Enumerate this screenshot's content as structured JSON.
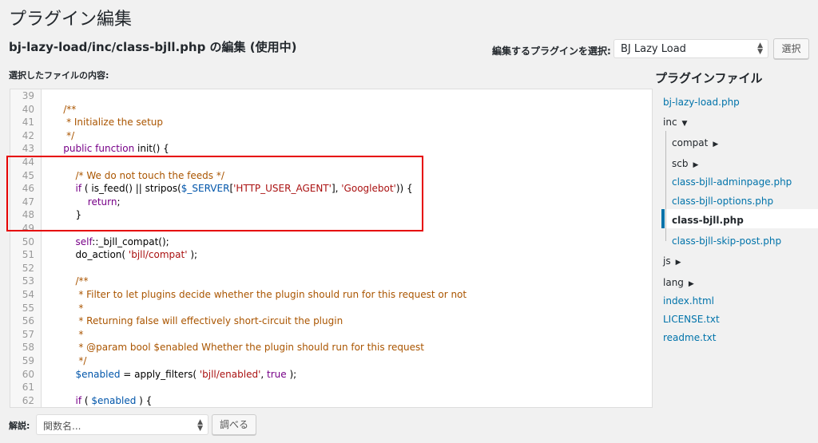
{
  "page_title": "プラグイン編集",
  "file_heading": "bj-lazy-load/inc/class-bjll.php の編集 (使用中)",
  "plugin_picker": {
    "label": "編集するプラグインを選択:",
    "selected": "BJ Lazy Load",
    "button": "選択"
  },
  "content_label": "選択したファイルの内容:",
  "code_lines": [
    {
      "n": "39",
      "segs": []
    },
    {
      "n": "40",
      "segs": [
        [
          "c",
          "    /**"
        ]
      ]
    },
    {
      "n": "41",
      "segs": [
        [
          "c",
          "     * Initialize the setup"
        ]
      ]
    },
    {
      "n": "42",
      "segs": [
        [
          "c",
          "     */"
        ]
      ]
    },
    {
      "n": "43",
      "segs": [
        [
          "k",
          "    public function "
        ],
        [
          "p",
          "init() {"
        ]
      ]
    },
    {
      "n": "44",
      "segs": []
    },
    {
      "n": "45",
      "segs": [
        [
          "c",
          "        /* We do not touch the feeds */"
        ]
      ]
    },
    {
      "n": "46",
      "segs": [
        [
          "k",
          "        if "
        ],
        [
          "p",
          "( is_feed() || stripos("
        ],
        [
          "v",
          "$_SERVER"
        ],
        [
          "p",
          "["
        ],
        [
          "s",
          "'HTTP_USER_AGENT'"
        ],
        [
          "p",
          "], "
        ],
        [
          "s",
          "'Googlebot'"
        ],
        [
          "p",
          ")) {"
        ]
      ]
    },
    {
      "n": "47",
      "segs": [
        [
          "k",
          "            return"
        ],
        [
          "p",
          ";"
        ]
      ]
    },
    {
      "n": "48",
      "segs": [
        [
          "p",
          "        }"
        ]
      ]
    },
    {
      "n": "49",
      "segs": []
    },
    {
      "n": "50",
      "segs": [
        [
          "k",
          "        self"
        ],
        [
          "p",
          "::_bjll_compat();"
        ]
      ]
    },
    {
      "n": "51",
      "segs": [
        [
          "p",
          "        do_action( "
        ],
        [
          "s",
          "'bjll/compat'"
        ],
        [
          "p",
          " );"
        ]
      ]
    },
    {
      "n": "52",
      "segs": []
    },
    {
      "n": "53",
      "segs": [
        [
          "c",
          "        /**"
        ]
      ]
    },
    {
      "n": "54",
      "segs": [
        [
          "c",
          "         * Filter to let plugins decide whether the plugin should run for this request or not"
        ]
      ]
    },
    {
      "n": "55",
      "segs": [
        [
          "c",
          "         *"
        ]
      ]
    },
    {
      "n": "56",
      "segs": [
        [
          "c",
          "         * Returning false will effectively short-circuit the plugin"
        ]
      ]
    },
    {
      "n": "57",
      "segs": [
        [
          "c",
          "         *"
        ]
      ]
    },
    {
      "n": "58",
      "segs": [
        [
          "c",
          "         * @param bool $enabled Whether the plugin should run for this request"
        ]
      ]
    },
    {
      "n": "59",
      "segs": [
        [
          "c",
          "         */"
        ]
      ]
    },
    {
      "n": "60",
      "segs": [
        [
          "v",
          "        $enabled"
        ],
        [
          "p",
          " = apply_filters( "
        ],
        [
          "s",
          "'bjll/enabled'"
        ],
        [
          "p",
          ", "
        ],
        [
          "k",
          "true"
        ],
        [
          "p",
          " );"
        ]
      ]
    },
    {
      "n": "61",
      "segs": []
    },
    {
      "n": "62",
      "segs": [
        [
          "k",
          "        if "
        ],
        [
          "p",
          "( "
        ],
        [
          "v",
          "$enabled"
        ],
        [
          "p",
          " ) {"
        ]
      ]
    }
  ],
  "file_tree": {
    "title": "プラグインファイル",
    "items": [
      {
        "label": "bj-lazy-load.php",
        "type": "file"
      },
      {
        "label": "inc",
        "type": "folder",
        "caret": "▼"
      },
      {
        "label": "compat",
        "type": "folder",
        "caret": "▶"
      },
      {
        "label": "scb",
        "type": "folder",
        "caret": "▶"
      },
      {
        "label": "class-bjll-adminpage.php",
        "type": "file"
      },
      {
        "label": "class-bjll-options.php",
        "type": "file"
      },
      {
        "label": "class-bjll.php",
        "type": "file",
        "current": true
      },
      {
        "label": "class-bjll-skip-post.php",
        "type": "file"
      },
      {
        "label": "js",
        "type": "folder",
        "caret": "▶"
      },
      {
        "label": "lang",
        "type": "folder",
        "caret": "▶"
      },
      {
        "label": "index.html",
        "type": "file"
      },
      {
        "label": "LICENSE.txt",
        "type": "file"
      },
      {
        "label": "readme.txt",
        "type": "file"
      }
    ]
  },
  "documentation": {
    "label": "解説:",
    "placeholder": "関数名...",
    "button": "調べる"
  },
  "colors": {
    "accent": "#0073aa",
    "highlight_border": "#e60000"
  },
  "icons": {
    "select_arrows": "up-down-arrows-icon",
    "folder_open": "caret-down-icon",
    "folder_closed": "caret-right-icon"
  }
}
